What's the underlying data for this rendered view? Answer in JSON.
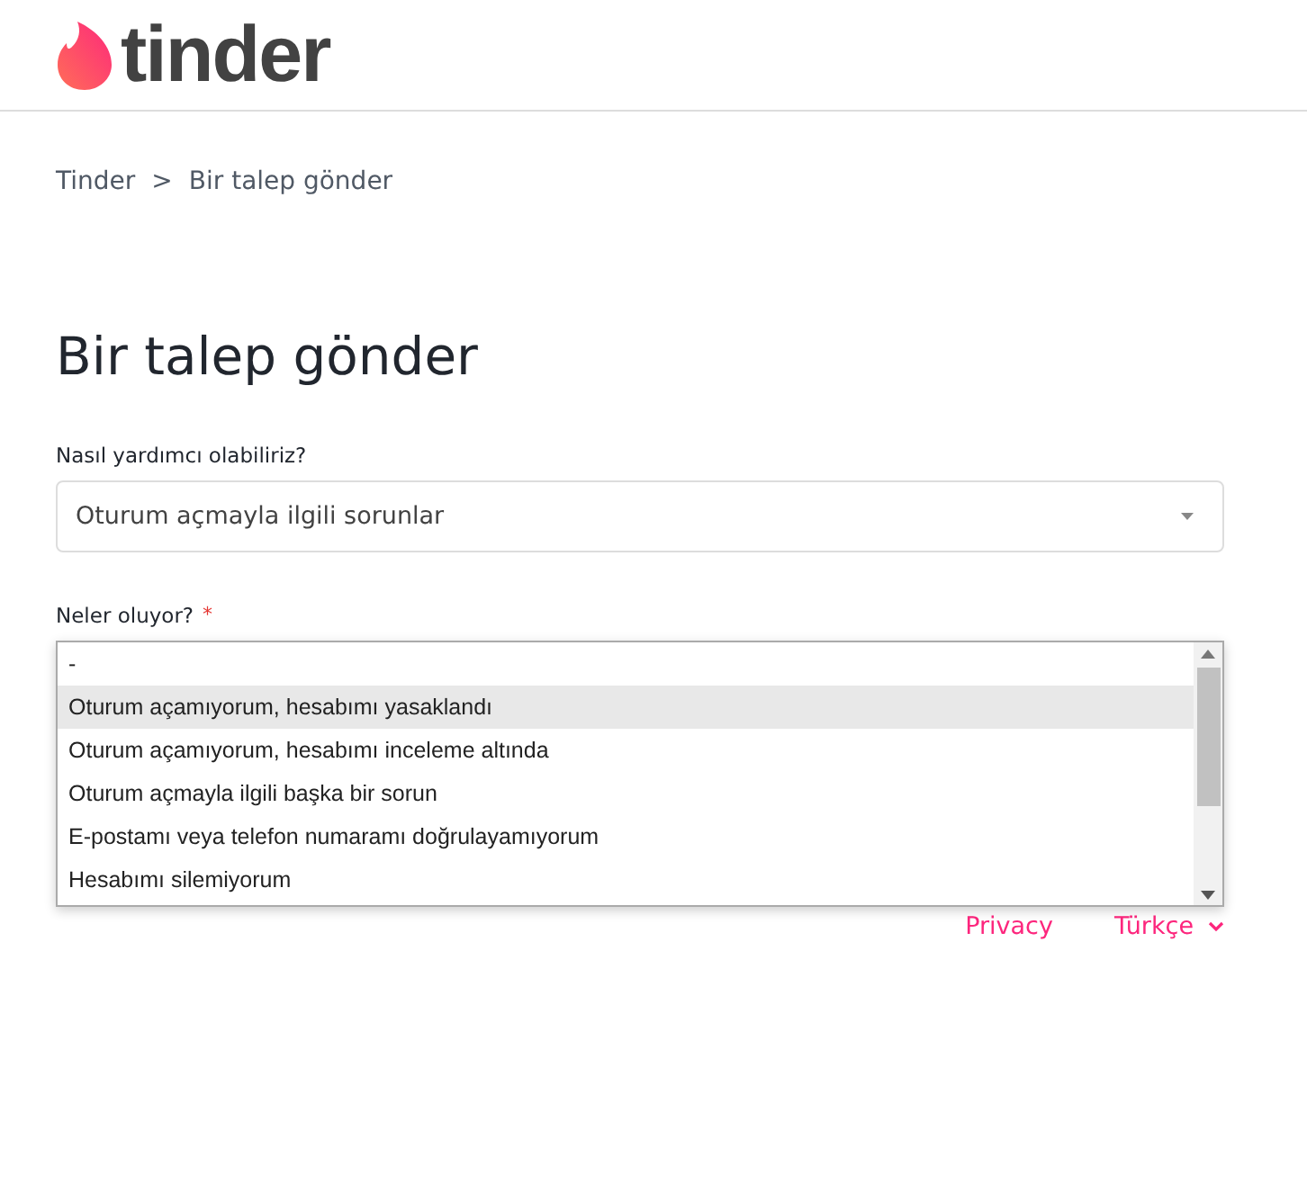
{
  "header": {
    "logo_text": "tinder"
  },
  "breadcrumb": {
    "items": [
      "Tinder",
      "Bir talep gönder"
    ],
    "separator": ">"
  },
  "title": "Bir talep gönder",
  "help_field": {
    "label": "Nasıl yardımcı olabiliriz?",
    "value": "Oturum açmayla ilgili sorunlar"
  },
  "issue_field": {
    "label": "Neler oluyor?",
    "required_mark": "*",
    "options": [
      {
        "label": "-",
        "selected": false
      },
      {
        "label": "Oturum açamıyorum, hesabımı yasaklandı",
        "selected": true
      },
      {
        "label": "Oturum açamıyorum, hesabımı inceleme altında",
        "selected": false
      },
      {
        "label": "Oturum açmayla ilgili başka bir sorun",
        "selected": false
      },
      {
        "label": "E-postamı veya telefon numaramı doğrulayamıyorum",
        "selected": false
      },
      {
        "label": "Hesabımı silemiyorum",
        "selected": false
      }
    ]
  },
  "footer": {
    "links": [
      "Privacy"
    ],
    "language": "Türkçe"
  }
}
